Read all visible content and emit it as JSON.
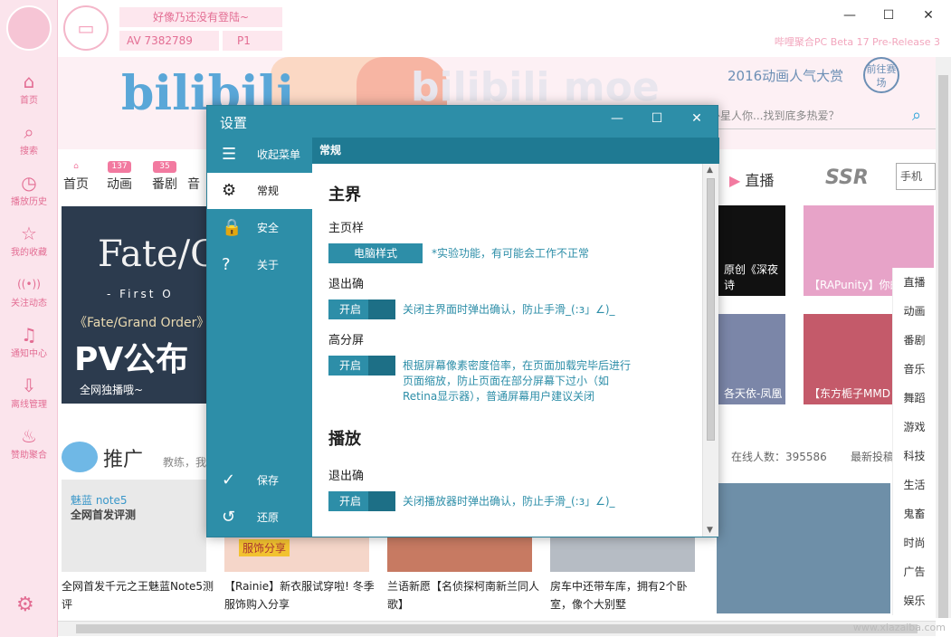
{
  "app": {
    "username_prompt": "好像乃还没有登陆~",
    "av_label": "AV",
    "av_number": "7382789",
    "p_label": "P",
    "p_number": "1",
    "version": "哔哩聚合PC Beta 17 Pre-Release 3"
  },
  "rail": [
    {
      "label": "首页",
      "icon": "home-icon",
      "glyph": "⌂"
    },
    {
      "label": "搜索",
      "icon": "search-icon",
      "glyph": "⌕"
    },
    {
      "label": "播放历史",
      "icon": "clock-icon",
      "glyph": "◷"
    },
    {
      "label": "我的收藏",
      "icon": "star-icon",
      "glyph": "☆"
    },
    {
      "label": "关注动态",
      "icon": "broadcast-icon",
      "glyph": "((•))"
    },
    {
      "label": "通知中心",
      "icon": "bell-icon",
      "glyph": "♫"
    },
    {
      "label": "离线管理",
      "icon": "download-icon",
      "glyph": "⇩"
    },
    {
      "label": "赞助聚合",
      "icon": "piggy-bank-icon",
      "glyph": "♨"
    }
  ],
  "banner": {
    "logo_text": "bilibili",
    "moe_text": "bilibili moe",
    "award_text": "2016动画人气大赏",
    "award_sub": "Bilibili moe",
    "goto_label": "前往赛场",
    "search_placeholder": "告诉外星人你...找到底多热爱？"
  },
  "tabs": [
    {
      "label": "首页",
      "badge": ""
    },
    {
      "label": "动画",
      "badge": "137"
    },
    {
      "label": "番剧",
      "badge": "35"
    },
    {
      "label": "音",
      "badge": ""
    }
  ],
  "featured": {
    "title": "Fate/Gra",
    "subtitle": "- First O",
    "line1": "《Fate/Grand Order》",
    "line2": "PV公布",
    "caption": "全网独播哦~"
  },
  "right_header": {
    "live": "直播",
    "ssr": "SSR",
    "mobile": "手机"
  },
  "thumbs": [
    {
      "caption": "原创《深夜诗"
    },
    {
      "caption": "【RAPunity】你的"
    },
    {
      "caption": "各天依-凤凰"
    },
    {
      "caption": "【东方栀子MMD"
    }
  ],
  "promo": {
    "title": "推广",
    "sub": "教练，我",
    "online": "在线人数：395586",
    "newest": "最新投稿"
  },
  "cards": [
    {
      "caption": "全网首发千元之王魅蓝Note5测评",
      "tag": "魅蓝 note5",
      "tag2": "全网首发评测"
    },
    {
      "caption": "【Rainie】新衣服试穿啦! 冬季服饰购入分享",
      "tag": "服饰分享"
    },
    {
      "caption": "兰语新愿【名侦探柯南新兰同人歌】"
    },
    {
      "caption": "房车中还带车库，拥有2个卧室，像个大别墅"
    }
  ],
  "side_categories": [
    "直播",
    "动画",
    "番剧",
    "音乐",
    "舞蹈",
    "游戏",
    "科技",
    "生活",
    "鬼畜",
    "时尚",
    "广告",
    "娱乐"
  ],
  "watermark": "www.xiazaiba.com",
  "dialog": {
    "title": "设置",
    "menu": [
      {
        "label": "收起菜单",
        "icon": "hamburger-icon",
        "glyph": "☰"
      },
      {
        "label": "常规",
        "icon": "gear-icon",
        "glyph": "⚙"
      },
      {
        "label": "安全",
        "icon": "lock-icon",
        "glyph": "🔒"
      },
      {
        "label": "关于",
        "icon": "help-icon",
        "glyph": "?"
      }
    ],
    "bottom": [
      {
        "label": "保存",
        "icon": "check-icon",
        "glyph": "✓"
      },
      {
        "label": "还原",
        "icon": "restore-icon",
        "glyph": "↺"
      }
    ],
    "header": "常规",
    "section1": "主界",
    "homestyle_label": "主页样",
    "homestyle_value": "电脑样式",
    "homestyle_hint": "*实验功能，有可能会工作不正常",
    "exit_label": "退出确",
    "exit_value": "开启",
    "exit_hint": "关闭主界面时弹出确认，防止手滑_(:з」∠)_",
    "hidpi_label": "高分屏",
    "hidpi_value": "开启",
    "hidpi_hint1": "根据屏幕像素密度倍率，在页面加载完毕后进行",
    "hidpi_hint2": "页面缩放，防止页面在部分屏幕下过小（如",
    "hidpi_hint3": "Retina显示器），普通屏幕用户建议关闭",
    "section2": "播放",
    "pexit_label": "退出确",
    "pexit_value": "开启",
    "pexit_hint": "关闭播放器时弹出确认，防止手滑_(:з」∠)_"
  },
  "colors": {
    "accent": "#2d8ea8",
    "pink": "#e36d93",
    "rail_bg": "#fbe4ec"
  }
}
